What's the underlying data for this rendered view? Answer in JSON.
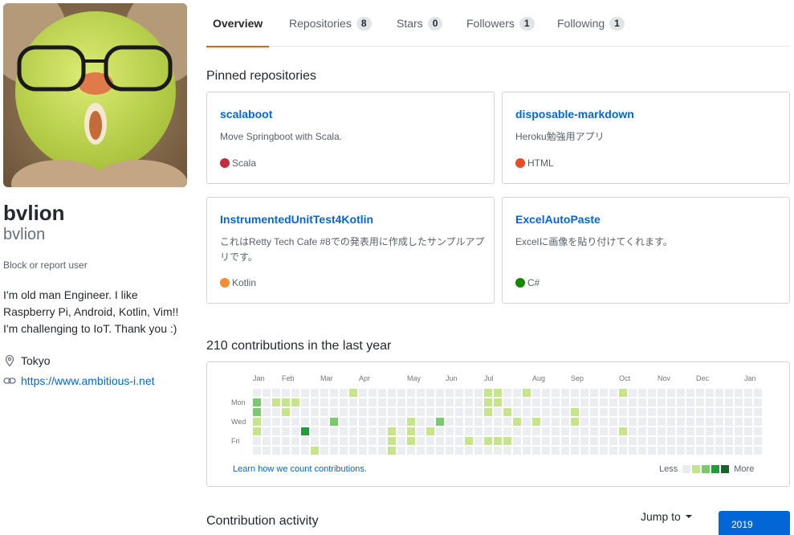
{
  "profile": {
    "full_name": "bvlion",
    "login": "bvlion",
    "block_report": "Block or report user",
    "bio_lines": [
      "I'm old man Engineer. I like",
      "Raspberry Pi, Android, Kotlin, Vim!!",
      "I'm challenging to IoT. Thank you :)"
    ],
    "location": "Tokyo",
    "website": "https://www.ambitious-i.net"
  },
  "tabs": [
    {
      "label": "Overview",
      "count": null,
      "selected": true
    },
    {
      "label": "Repositories",
      "count": "8",
      "selected": false
    },
    {
      "label": "Stars",
      "count": "0",
      "selected": false
    },
    {
      "label": "Followers",
      "count": "1",
      "selected": false
    },
    {
      "label": "Following",
      "count": "1",
      "selected": false
    }
  ],
  "pinned": {
    "title": "Pinned repositories",
    "repos": [
      {
        "name": "scalaboot",
        "description": "Move Springboot with Scala.",
        "language": "Scala",
        "color": "#c22d40"
      },
      {
        "name": "disposable-markdown",
        "description": "Heroku勉強用アプリ",
        "language": "HTML",
        "color": "#e34c26"
      },
      {
        "name": "InstrumentedUnitTest4Kotlin",
        "description": "これはRetty Tech Cafe #8での発表用に作成したサンプルアプリです。",
        "language": "Kotlin",
        "color": "#F18E33"
      },
      {
        "name": "ExcelAutoPaste",
        "description": "Excelに画像を貼り付けてくれます。",
        "language": "C#",
        "color": "#178600"
      }
    ]
  },
  "contributions": {
    "title": "210 contributions in the last year",
    "months": [
      "Jan",
      "Feb",
      "Mar",
      "Apr",
      "May",
      "Jun",
      "Jul",
      "Aug",
      "Sep",
      "Oct",
      "Nov",
      "Dec",
      "Jan"
    ],
    "days": [
      "Mon",
      "Wed",
      "Fri"
    ],
    "learn_link": "Learn how we count contributions.",
    "legend_less": "Less",
    "legend_more": "More",
    "colors": [
      "#ebedf0",
      "#c6e48b",
      "#7bc96f",
      "#239a3b",
      "#196127"
    ],
    "weeks": [
      [
        0,
        2,
        2,
        1,
        1,
        0,
        0
      ],
      [
        0,
        0,
        0,
        0,
        0,
        0,
        0
      ],
      [
        0,
        1,
        0,
        0,
        0,
        0,
        0
      ],
      [
        0,
        1,
        1,
        0,
        0,
        0,
        0
      ],
      [
        0,
        1,
        0,
        0,
        0,
        0,
        0
      ],
      [
        0,
        0,
        0,
        0,
        3,
        0,
        0
      ],
      [
        0,
        0,
        0,
        0,
        0,
        0,
        1
      ],
      [
        0,
        0,
        0,
        0,
        0,
        0,
        0
      ],
      [
        0,
        0,
        0,
        2,
        0,
        0,
        0
      ],
      [
        0,
        0,
        0,
        0,
        0,
        0,
        0
      ],
      [
        1,
        0,
        0,
        0,
        0,
        0,
        0
      ],
      [
        0,
        0,
        0,
        0,
        0,
        0,
        0
      ],
      [
        0,
        0,
        0,
        0,
        0,
        0,
        0
      ],
      [
        0,
        0,
        0,
        0,
        0,
        0,
        0
      ],
      [
        0,
        0,
        0,
        0,
        1,
        1,
        1
      ],
      [
        0,
        0,
        0,
        0,
        0,
        0,
        0
      ],
      [
        0,
        0,
        0,
        1,
        1,
        1,
        0
      ],
      [
        0,
        0,
        0,
        0,
        0,
        0,
        0
      ],
      [
        0,
        0,
        0,
        0,
        1,
        0,
        0
      ],
      [
        0,
        0,
        0,
        2,
        0,
        0,
        0
      ],
      [
        0,
        0,
        0,
        0,
        0,
        0,
        0
      ],
      [
        0,
        0,
        0,
        0,
        0,
        0,
        0
      ],
      [
        0,
        0,
        0,
        0,
        0,
        1,
        0
      ],
      [
        0,
        0,
        0,
        0,
        0,
        0,
        0
      ],
      [
        1,
        1,
        1,
        0,
        0,
        1,
        0
      ],
      [
        1,
        1,
        0,
        0,
        0,
        1,
        0
      ],
      [
        0,
        0,
        1,
        0,
        0,
        1,
        0
      ],
      [
        0,
        0,
        0,
        1,
        0,
        0,
        0
      ],
      [
        1,
        0,
        0,
        0,
        0,
        0,
        0
      ],
      [
        0,
        0,
        0,
        1,
        0,
        0,
        0
      ],
      [
        0,
        0,
        0,
        0,
        0,
        0,
        0
      ],
      [
        0,
        0,
        0,
        0,
        0,
        0,
        0
      ],
      [
        0,
        0,
        0,
        0,
        0,
        0,
        0
      ],
      [
        0,
        0,
        1,
        1,
        0,
        0,
        0
      ],
      [
        0,
        0,
        0,
        0,
        0,
        0,
        0
      ],
      [
        0,
        0,
        0,
        0,
        0,
        0,
        0
      ],
      [
        0,
        0,
        0,
        0,
        0,
        0,
        0
      ],
      [
        0,
        0,
        0,
        0,
        0,
        0,
        0
      ],
      [
        1,
        0,
        0,
        0,
        1,
        0,
        0
      ],
      [
        0,
        0,
        0,
        0,
        0,
        0,
        0
      ],
      [
        0,
        0,
        0,
        0,
        0,
        0,
        0
      ],
      [
        0,
        0,
        0,
        0,
        0,
        0,
        0
      ],
      [
        0,
        0,
        0,
        0,
        0,
        0,
        0
      ],
      [
        0,
        0,
        0,
        0,
        0,
        0,
        0
      ],
      [
        0,
        0,
        0,
        0,
        0,
        0,
        0
      ],
      [
        0,
        0,
        0,
        0,
        0,
        0,
        0
      ],
      [
        0,
        0,
        0,
        0,
        0,
        0,
        0
      ],
      [
        0,
        0,
        0,
        0,
        0,
        0,
        0
      ],
      [
        0,
        0,
        0,
        0,
        0,
        0,
        0
      ],
      [
        0,
        0,
        0,
        0,
        0,
        0,
        0
      ],
      [
        0,
        0,
        0,
        0,
        0,
        0,
        0
      ],
      [
        0,
        0,
        0,
        0,
        0,
        0,
        0
      ],
      [
        0,
        0,
        0,
        0,
        0,
        0,
        0
      ]
    ]
  },
  "activity": {
    "title": "Contribution activity",
    "jump_to": "Jump to",
    "year": "2019"
  }
}
